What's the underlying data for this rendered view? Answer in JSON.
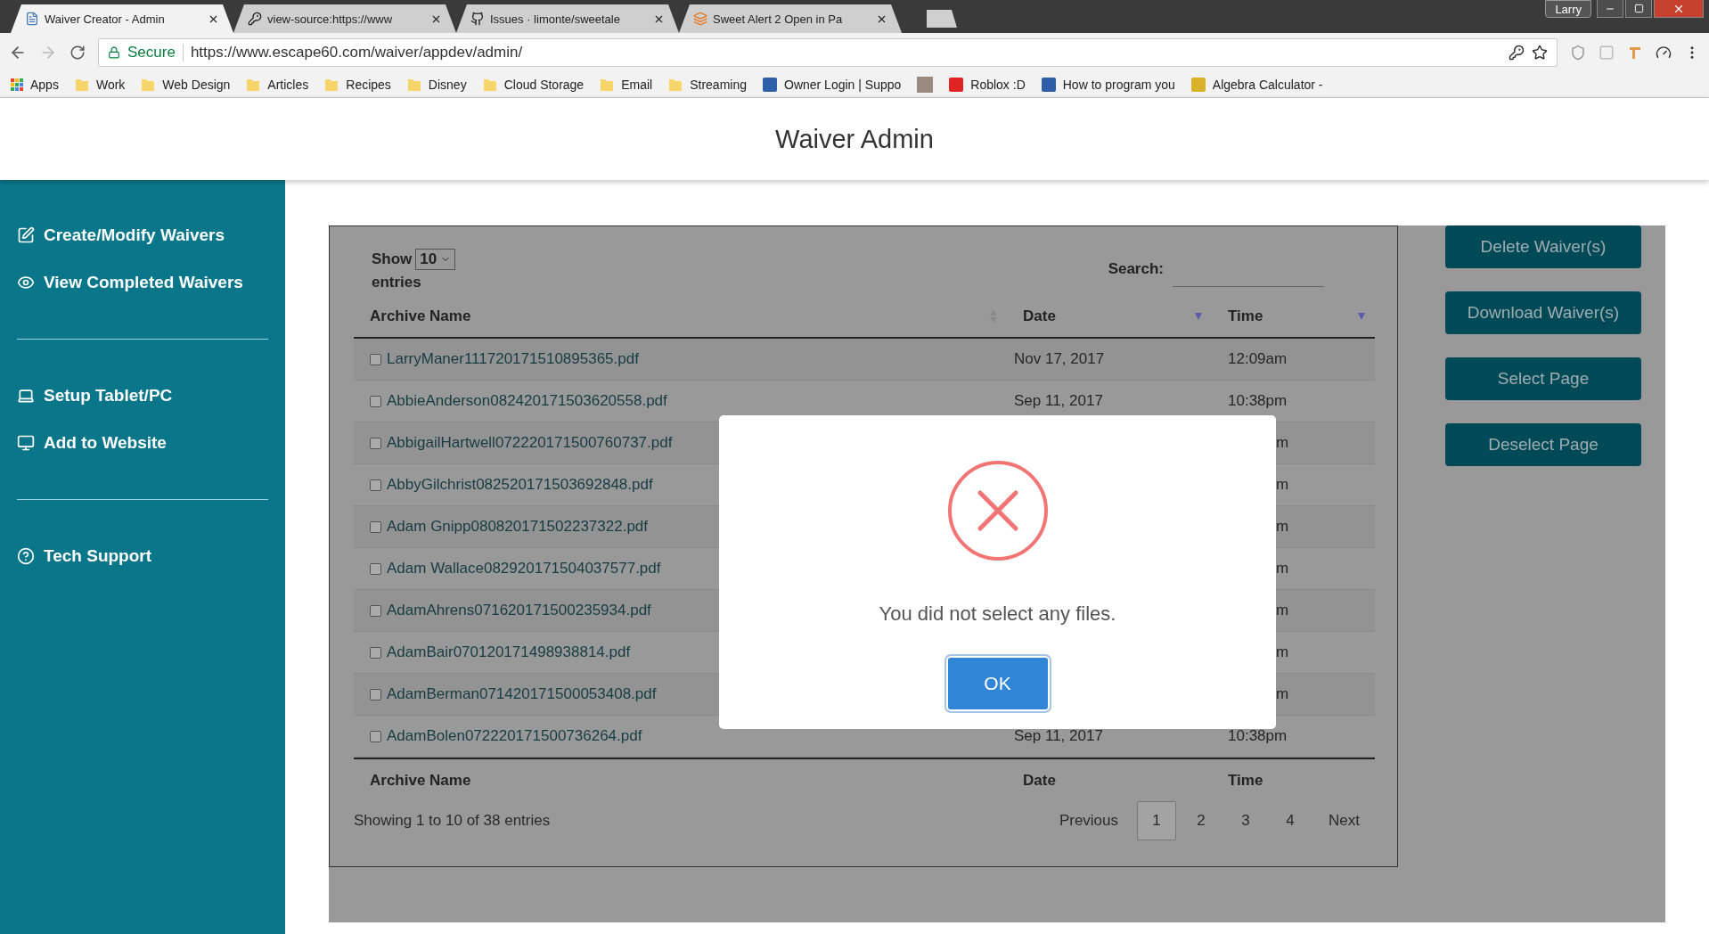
{
  "browser": {
    "tabs": [
      {
        "title": "Waiver Creator - Admin",
        "selected": true,
        "kind": "page"
      },
      {
        "title": "view-source:https://www",
        "selected": false,
        "kind": "key"
      },
      {
        "title": "Issues · limonte/sweetale",
        "selected": false,
        "kind": "github"
      },
      {
        "title": "Sweet Alert 2 Open in Pa",
        "selected": false,
        "kind": "stack"
      }
    ],
    "profile": "Larry",
    "address": {
      "security": "Secure",
      "url": "https://www.escape60.com/waiver/appdev/admin/"
    },
    "bookmarks": [
      {
        "kind": "apps",
        "label": "Apps"
      },
      {
        "kind": "folder",
        "label": "Work"
      },
      {
        "kind": "folder",
        "label": "Web Design"
      },
      {
        "kind": "folder",
        "label": "Articles"
      },
      {
        "kind": "folder",
        "label": "Recipes"
      },
      {
        "kind": "folder",
        "label": "Disney"
      },
      {
        "kind": "folder",
        "label": "Cloud Storage"
      },
      {
        "kind": "folder",
        "label": "Email"
      },
      {
        "kind": "folder",
        "label": "Streaming"
      },
      {
        "kind": "site",
        "label": "Owner Login | Suppo",
        "color": "#2d5fa8"
      },
      {
        "kind": "photo"
      },
      {
        "kind": "site",
        "label": "Roblox :D",
        "color": "#e02424"
      },
      {
        "kind": "site",
        "label": "How to program you",
        "color": "#2d5fa8"
      },
      {
        "kind": "site",
        "label": "Algebra Calculator -",
        "color": "#d9b22a"
      }
    ]
  },
  "header": {
    "title": "Waiver Admin"
  },
  "sidebar": {
    "groups": [
      {
        "items": [
          {
            "kind": "edit",
            "label": "Create/Modify Waivers"
          },
          {
            "kind": "view",
            "label": "View Completed Waivers"
          }
        ]
      },
      {
        "items": [
          {
            "kind": "laptop",
            "label": "Setup Tablet/PC"
          },
          {
            "kind": "monitor",
            "label": "Add to Website"
          }
        ]
      },
      {
        "items": [
          {
            "kind": "help",
            "label": "Tech Support"
          }
        ]
      }
    ]
  },
  "table": {
    "show_label": "Show",
    "length": "10",
    "entries_label": "entries",
    "search_label": "Search:",
    "columns": [
      {
        "label": "Archive Name",
        "sorted_descending": false
      },
      {
        "label": "Date",
        "sorted_descending": true
      },
      {
        "label": "Time",
        "sorted_descending": true
      }
    ],
    "rows": [
      {
        "name": "LarryManer111720171510895365.pdf",
        "date": "Nov 17, 2017",
        "time": "12:09am",
        "checked": false
      },
      {
        "name": "AbbieAnderson082420171503620558.pdf",
        "date": "Sep 11, 2017",
        "time": "10:38pm",
        "checked": false
      },
      {
        "name": "AbbigailHartwell072220171500760737.pdf",
        "time": "m",
        "checked": false
      },
      {
        "name": "AbbyGilchrist082520171503692848.pdf",
        "time": "m",
        "checked": false
      },
      {
        "name": "Adam Gnipp080820171502237322.pdf",
        "time": "m",
        "checked": false
      },
      {
        "name": "Adam Wallace082920171504037577.pdf",
        "time": "m",
        "checked": false
      },
      {
        "name": "AdamAhrens071620171500235934.pdf",
        "time": "m",
        "checked": false
      },
      {
        "name": "AdamBair070120171498938814.pdf",
        "time": "m",
        "checked": false
      },
      {
        "name": "AdamBerman071420171500053408.pdf",
        "time": "m",
        "checked": false
      },
      {
        "name": "AdamBolen072220171500736264.pdf",
        "date": "Sep 11, 2017",
        "time": "10:38pm",
        "checked": false
      }
    ],
    "footer_columns": [
      "Archive Name",
      "Date",
      "Time"
    ],
    "info": "Showing 1 to 10 of 38 entries",
    "pagination": {
      "previous": "Previous",
      "pages": [
        {
          "label": "1",
          "selected": true
        },
        {
          "label": "2",
          "selected": false
        },
        {
          "label": "3",
          "selected": false
        },
        {
          "label": "4",
          "selected": false
        }
      ],
      "next": "Next"
    }
  },
  "actions": [
    "Delete Waiver(s)",
    "Download Waiver(s)",
    "Select Page",
    "Deselect Page"
  ],
  "dialog": {
    "message": "You did not select any files.",
    "confirm": "OK"
  }
}
